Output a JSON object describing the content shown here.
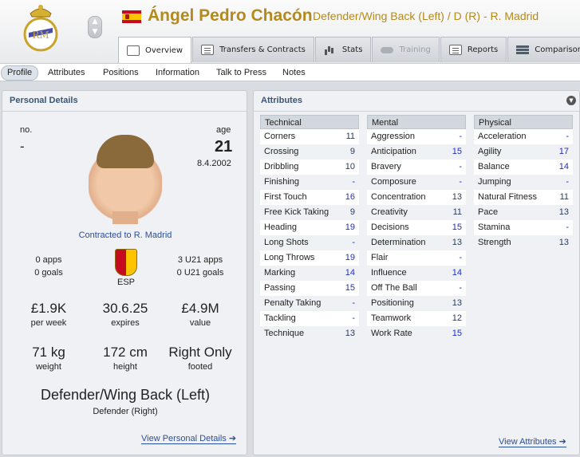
{
  "header": {
    "player_name": "Ángel Pedro Chacón",
    "subtitle": "Defender/Wing Back (Left) / D (R) - R. Madrid",
    "arrow_up": "▲",
    "arrow_down": "▼"
  },
  "tabs": [
    {
      "label": "Overview",
      "icon": "profile-card-icon"
    },
    {
      "label": "Transfers & Contracts",
      "icon": "document-icon"
    },
    {
      "label": "Stats",
      "icon": "bar-chart-icon"
    },
    {
      "label": "Training",
      "icon": "cloud-icon"
    },
    {
      "label": "Reports",
      "icon": "report-icon"
    },
    {
      "label": "Comparison",
      "icon": "compare-icon"
    }
  ],
  "subnav": [
    "Profile",
    "Attributes",
    "Positions",
    "Information",
    "Talk to Press",
    "Notes"
  ],
  "personal": {
    "title": "Personal Details",
    "no_label": "no.",
    "no_value": "-",
    "age_label": "age",
    "age_value": "21",
    "dob": "8.4.2002",
    "contract": "Contracted to R. Madrid",
    "apps": "0 apps",
    "goals": "0 goals",
    "nation": "ESP",
    "u21_apps": "3 U21 apps",
    "u21_goals": "0 U21 goals",
    "wage": "£1.9K",
    "wage_label": "per week",
    "expires": "30.6.25",
    "expires_label": "expires",
    "value": "£4.9M",
    "value_label": "value",
    "weight": "71 kg",
    "weight_label": "weight",
    "height": "172 cm",
    "height_label": "height",
    "foot": "Right Only",
    "foot_label": "footed",
    "position": "Defender/Wing Back (Left)",
    "position_sub": "Defender (Right)",
    "link": "View Personal Details"
  },
  "attributes": {
    "title": "Attributes",
    "link": "View Attributes",
    "technical": {
      "label": "Technical",
      "rows": [
        {
          "name": "Corners",
          "value": "11"
        },
        {
          "name": "Crossing",
          "value": "9"
        },
        {
          "name": "Dribbling",
          "value": "10"
        },
        {
          "name": "Finishing",
          "value": "-"
        },
        {
          "name": "First Touch",
          "value": "16"
        },
        {
          "name": "Free Kick Taking",
          "value": "9"
        },
        {
          "name": "Heading",
          "value": "19"
        },
        {
          "name": "Long Shots",
          "value": "-"
        },
        {
          "name": "Long Throws",
          "value": "19"
        },
        {
          "name": "Marking",
          "value": "14"
        },
        {
          "name": "Passing",
          "value": "15"
        },
        {
          "name": "Penalty Taking",
          "value": "-"
        },
        {
          "name": "Tackling",
          "value": "-"
        },
        {
          "name": "Technique",
          "value": "13"
        }
      ]
    },
    "mental": {
      "label": "Mental",
      "rows": [
        {
          "name": "Aggression",
          "value": "-"
        },
        {
          "name": "Anticipation",
          "value": "15"
        },
        {
          "name": "Bravery",
          "value": "-"
        },
        {
          "name": "Composure",
          "value": "-"
        },
        {
          "name": "Concentration",
          "value": "13"
        },
        {
          "name": "Creativity",
          "value": "11"
        },
        {
          "name": "Decisions",
          "value": "15"
        },
        {
          "name": "Determination",
          "value": "13"
        },
        {
          "name": "Flair",
          "value": "-"
        },
        {
          "name": "Influence",
          "value": "14"
        },
        {
          "name": "Off The Ball",
          "value": "-"
        },
        {
          "name": "Positioning",
          "value": "13"
        },
        {
          "name": "Teamwork",
          "value": "12"
        },
        {
          "name": "Work Rate",
          "value": "15"
        }
      ]
    },
    "physical": {
      "label": "Physical",
      "rows": [
        {
          "name": "Acceleration",
          "value": "-"
        },
        {
          "name": "Agility",
          "value": "17"
        },
        {
          "name": "Balance",
          "value": "14"
        },
        {
          "name": "Jumping",
          "value": "-"
        },
        {
          "name": "Natural Fitness",
          "value": "11"
        },
        {
          "name": "Pace",
          "value": "13"
        },
        {
          "name": "Stamina",
          "value": "-"
        },
        {
          "name": "Strength",
          "value": "13"
        }
      ]
    }
  },
  "colors": {
    "name_gold": "#b48a1a",
    "title_blue": "#3c5572",
    "link_blue": "#2a4ea0",
    "high_value": "#1e2fc9"
  }
}
